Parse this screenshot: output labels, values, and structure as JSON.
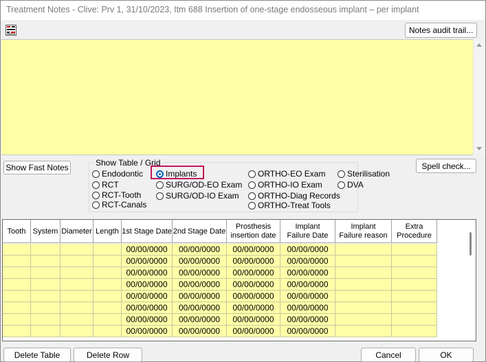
{
  "window": {
    "title": "Treatment Notes - Clive: Prv 1, 31/10/2023, Itm 688 Insertion of one-stage endosseous implant – per implant"
  },
  "toolbar": {
    "spell_icon": "spell-check-icon",
    "notes_audit_label": "Notes audit trail..."
  },
  "notes": {
    "value": ""
  },
  "buttons": {
    "show_fast_notes": "Show Fast Notes",
    "spell_check": "Spell check...",
    "delete_table": "Delete Table",
    "delete_row": "Delete Row",
    "cancel": "Cancel",
    "ok": "OK"
  },
  "show_table": {
    "label": "Show Table / Grid",
    "options": [
      {
        "label": "Endodontic",
        "selected": false
      },
      {
        "label": "RCT",
        "selected": false
      },
      {
        "label": "RCT-Tooth",
        "selected": false
      },
      {
        "label": "RCT-Canals",
        "selected": false
      },
      {
        "label": "Implants",
        "selected": true
      },
      {
        "label": "SURG/OD-EO Exam",
        "selected": false
      },
      {
        "label": "SURG/OD-IO Exam",
        "selected": false
      },
      {
        "label": "ORTHO-EO Exam",
        "selected": false
      },
      {
        "label": "ORTHO-IO Exam",
        "selected": false
      },
      {
        "label": "ORTHO-Diag Records",
        "selected": false
      },
      {
        "label": "ORTHO-Treat Tools",
        "selected": false
      },
      {
        "label": "Sterilisation",
        "selected": false
      },
      {
        "label": "DVA",
        "selected": false
      }
    ]
  },
  "grid": {
    "columns": [
      {
        "label": "Tooth"
      },
      {
        "label": "System"
      },
      {
        "label": "Diameter"
      },
      {
        "label": "Length"
      },
      {
        "label": "1st Stage Date"
      },
      {
        "label": "2nd Stage Date"
      },
      {
        "label": "Prosthesis\ninsertion date"
      },
      {
        "label": "Implant\nFailure Date"
      },
      {
        "label": "Implant\nFailure reason"
      },
      {
        "label": "Extra\nProcedure"
      }
    ],
    "rows": [
      [
        "",
        "",
        "",
        "",
        "00/00/0000",
        "00/00/0000",
        "00/00/0000",
        "00/00/0000",
        "",
        ""
      ],
      [
        "",
        "",
        "",
        "",
        "00/00/0000",
        "00/00/0000",
        "00/00/0000",
        "00/00/0000",
        "",
        ""
      ],
      [
        "",
        "",
        "",
        "",
        "00/00/0000",
        "00/00/0000",
        "00/00/0000",
        "00/00/0000",
        "",
        ""
      ],
      [
        "",
        "",
        "",
        "",
        "00/00/0000",
        "00/00/0000",
        "00/00/0000",
        "00/00/0000",
        "",
        ""
      ],
      [
        "",
        "",
        "",
        "",
        "00/00/0000",
        "00/00/0000",
        "00/00/0000",
        "00/00/0000",
        "",
        ""
      ],
      [
        "",
        "",
        "",
        "",
        "00/00/0000",
        "00/00/0000",
        "00/00/0000",
        "00/00/0000",
        "",
        ""
      ],
      [
        "",
        "",
        "",
        "",
        "00/00/0000",
        "00/00/0000",
        "00/00/0000",
        "00/00/0000",
        "",
        ""
      ],
      [
        "",
        "",
        "",
        "",
        "00/00/0000",
        "00/00/0000",
        "00/00/0000",
        "00/00/0000",
        "",
        ""
      ]
    ]
  },
  "colors": {
    "note_bg": "#ffffa8",
    "accent": "#0067c0",
    "focus": "#c0185b"
  }
}
